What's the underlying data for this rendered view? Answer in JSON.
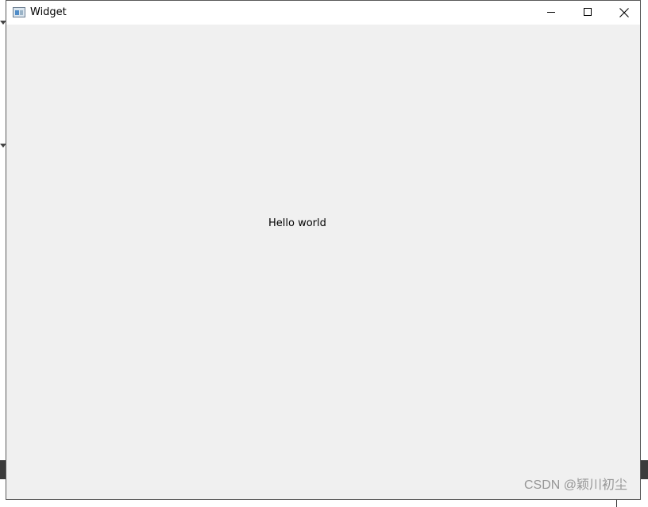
{
  "window": {
    "title": "Widget",
    "icon": "qt-window-icon"
  },
  "controls": {
    "minimize_icon": "minimize-icon",
    "maximize_icon": "maximize-icon",
    "close_icon": "close-icon"
  },
  "client": {
    "label_text": "Hello world"
  },
  "watermark": {
    "text": "CSDN @颖川初尘"
  },
  "colors": {
    "client_bg": "#f0f0f0",
    "titlebar_bg": "#ffffff",
    "border": "#5a5a5a"
  }
}
